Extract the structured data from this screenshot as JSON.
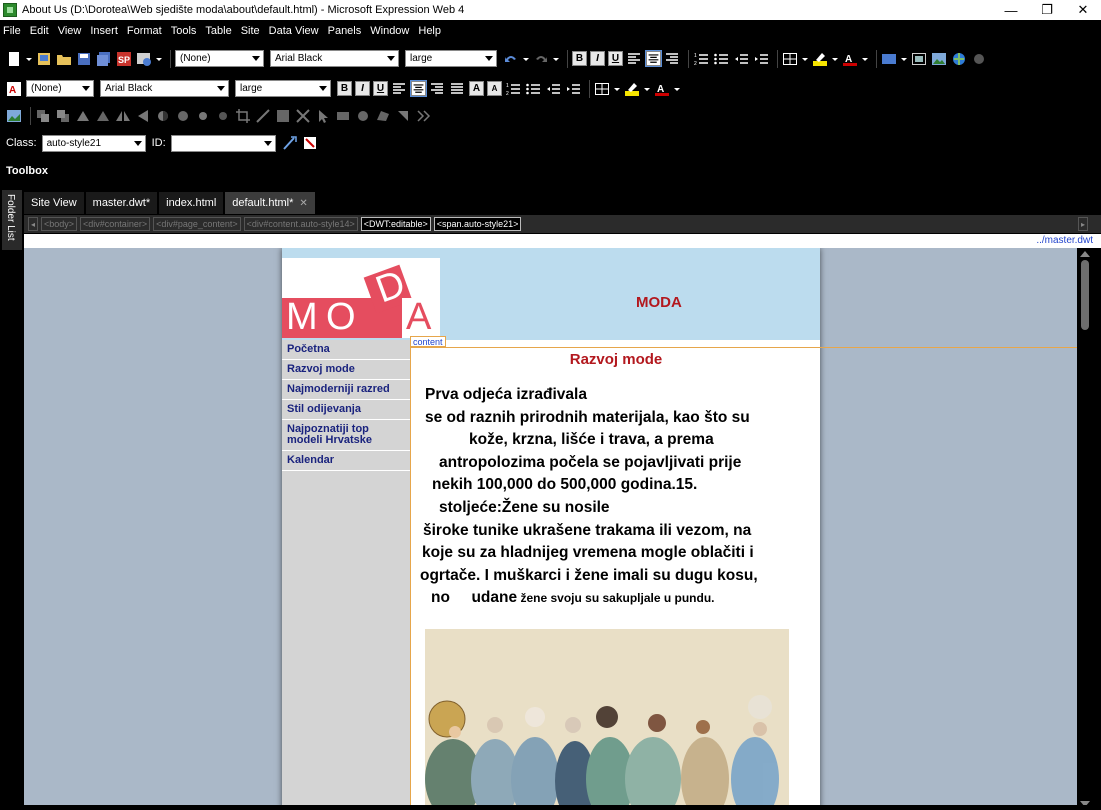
{
  "window": {
    "title": "About Us (D:\\Dorotea\\Web sjedište moda\\about\\default.html) - Microsoft Expression Web 4",
    "minimize": "—",
    "maximize": "❐",
    "close": "✕"
  },
  "menu": [
    "File",
    "Edit",
    "View",
    "Insert",
    "Format",
    "Tools",
    "Table",
    "Site",
    "Data View",
    "Panels",
    "Window",
    "Help"
  ],
  "toolbar1": {
    "style": "(None)",
    "font": "Arial Black",
    "size": "large"
  },
  "toolbar2": {
    "style": "(None)",
    "font": "Arial Black",
    "size": "large"
  },
  "toolbar4": {
    "class_label": "Class:",
    "class_value": "auto-style21",
    "id_label": "ID:",
    "id_value": ""
  },
  "toolbox_label": "Toolbox",
  "side_panel_label": "Folder List",
  "tabs": [
    {
      "label": "Site View",
      "active": false
    },
    {
      "label": "master.dwt*",
      "active": false
    },
    {
      "label": "index.html",
      "active": false
    },
    {
      "label": "default.html*",
      "active": true
    }
  ],
  "breadcrumbs": [
    "<body>",
    "<div#container>",
    "<div#page_content>",
    "<div#content.auto-style14>",
    "<DWT:editable>",
    "<span.auto-style21>"
  ],
  "master_link": "../master.dwt",
  "site": {
    "header_title": "MODA",
    "logo_letters": [
      "M",
      "O",
      "D",
      "A"
    ],
    "nav": [
      "Početna",
      "Razvoj mode",
      "Najmoderniji razred",
      "Stil odijevanja",
      "Najpoznatiji top modeli Hrvatske",
      "Kalendar"
    ],
    "content_label": "content",
    "content_title": "Razvoj mode",
    "paragraph_lines": [
      "Prva odjeća izrađivala",
      " se od raznih prirodnih materijala, kao što su",
      "kože, krzna, lišće i trava, a prema",
      "antropolozima počela se pojavljivati prije",
      "nekih 100,000 do 500,000 godina.15.",
      "stoljeće:Žene su nosile",
      "široke tunike ukrašene trakama ili vezom, na",
      "koje su za hladnijeg vremena mogle oblačiti i",
      "ogrtače. I muškarci i žene imali su dugu kosu,",
      "no     udane"
    ],
    "paragraph_tail": " žene svoju su sakupljale u pundu."
  },
  "colors": {
    "header_bg": "#bcdcee",
    "accent_red": "#b3181e",
    "logo_pink": "#e54d5f",
    "nav_link": "#1a237e",
    "content_border": "#e6a64b"
  }
}
